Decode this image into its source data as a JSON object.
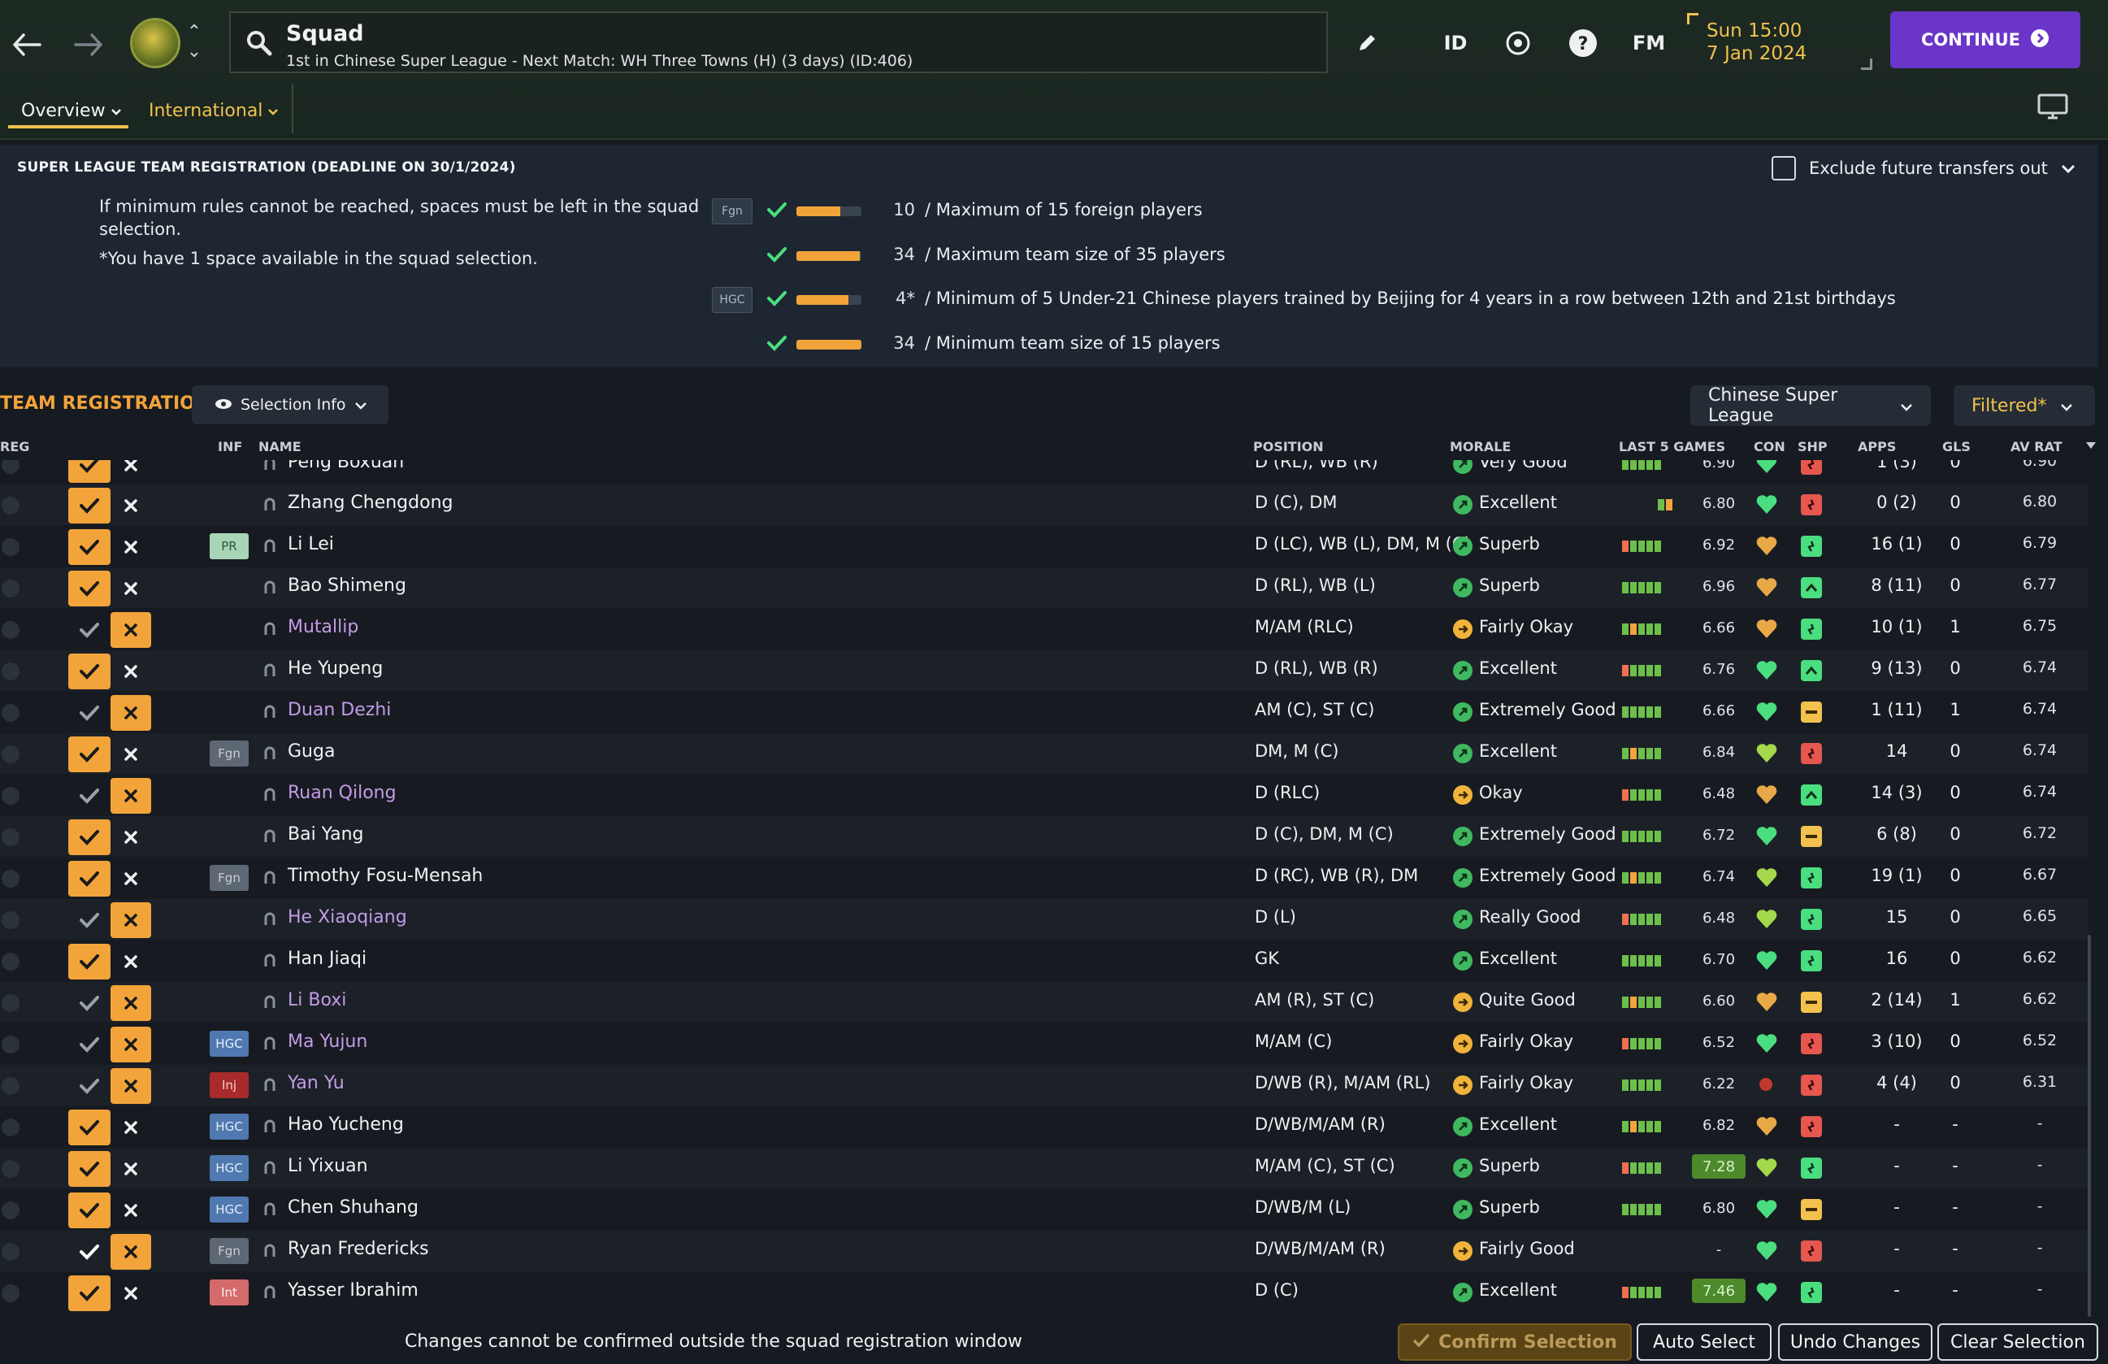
{
  "header": {
    "title": "Squad",
    "subtitle": "1st in Chinese Super League - Next Match: WH Three Towns (H) (3 days) (ID:406)",
    "id_label": "ID",
    "fm_label": "FM",
    "date_time": "Sun 15:00",
    "date": "7 Jan 2024",
    "continue_label": "CONTINUE"
  },
  "tabs": {
    "overview": "Overview",
    "international": "International"
  },
  "registration": {
    "title": "SUPER LEAGUE TEAM REGISTRATION (DEADLINE ON 30/1/2024)",
    "note": "If minimum rules cannot be reached, spaces must be left in the squad selection.",
    "note2": "*You have 1 space available in the squad selection.",
    "exclude_label": "Exclude future transfers out",
    "rules": [
      {
        "badge": "Fgn",
        "value": "10",
        "fill": 0.67,
        "text": "/  Maximum of 15 foreign players"
      },
      {
        "badge": "",
        "value": "34",
        "fill": 0.97,
        "text": "/  Maximum team size of 35 players"
      },
      {
        "badge": "HGC",
        "value": "4*",
        "fill": 0.8,
        "text": "/  Minimum of 5 Under-21 Chinese players trained by Beijing for 4 years in a row between 12th and 21st birthdays"
      },
      {
        "badge": "",
        "value": "34",
        "fill": 1.0,
        "text": "/  Minimum team size of 15 players"
      }
    ]
  },
  "team_reg": {
    "label": "TEAM REGISTRATION",
    "selection_info": "Selection Info",
    "league_filter": "Chinese Super League",
    "filtered": "Filtered*"
  },
  "columns": {
    "reg": "REG",
    "inf": "INF",
    "name": "NAME",
    "position": "POSITION",
    "morale": "MORALE",
    "last5": "LAST 5 GAMES",
    "con": "CON",
    "shp": "SHP",
    "apps": "APPS",
    "gls": "GLS",
    "avrat": "AV RAT"
  },
  "players": [
    {
      "name": "Peng Boxuan",
      "reg": true,
      "inf": "",
      "pos": "D (RL), WB (R)",
      "mood": "g",
      "morale": "Very Good",
      "avg": "6.90",
      "apps": "1 (3)",
      "gls": "0",
      "avrat": "6.90",
      "con": "#4ade80",
      "shp": "r",
      "hi": false,
      "partial": true
    },
    {
      "name": "Zhang Chengdong",
      "reg": true,
      "inf": "",
      "pos": "D (C), DM",
      "mood": "g",
      "morale": "Excellent",
      "avg": "6.80",
      "apps": "0 (2)",
      "gls": "0",
      "avrat": "6.80",
      "con": "#4ade80",
      "shp": "r",
      "hi": false
    },
    {
      "name": "Li Lei",
      "reg": true,
      "inf": "PR",
      "pos": "D (LC), WB (L), DM, M (C)",
      "mood": "g",
      "morale": "Superb",
      "avg": "6.92",
      "apps": "16 (1)",
      "gls": "0",
      "avrat": "6.79",
      "con": "#e8a847",
      "shp": "g",
      "hi": false
    },
    {
      "name": "Bao Shimeng",
      "reg": true,
      "inf": "",
      "pos": "D (RL), WB (L)",
      "mood": "g",
      "morale": "Superb",
      "avg": "6.96",
      "apps": "8 (11)",
      "gls": "0",
      "avrat": "6.77",
      "con": "#e8a847",
      "shp": "up",
      "hi": false
    },
    {
      "name": "Mutallip",
      "reg": false,
      "inf": "",
      "pos": "M/AM (RLC)",
      "mood": "y",
      "morale": "Fairly Okay",
      "avg": "6.66",
      "apps": "10 (1)",
      "gls": "1",
      "avrat": "6.75",
      "con": "#e8a847",
      "shp": "g",
      "hi": false
    },
    {
      "name": "He Yupeng",
      "reg": true,
      "inf": "",
      "pos": "D (RL), WB (R)",
      "mood": "g",
      "morale": "Excellent",
      "avg": "6.76",
      "apps": "9 (13)",
      "gls": "0",
      "avrat": "6.74",
      "con": "#4ade80",
      "shp": "up",
      "hi": false
    },
    {
      "name": "Duan Dezhi",
      "reg": false,
      "inf": "",
      "pos": "AM (C), ST (C)",
      "mood": "g",
      "morale": "Extremely Good",
      "avg": "6.66",
      "apps": "1 (11)",
      "gls": "1",
      "avrat": "6.74",
      "con": "#4ade80",
      "shp": "y",
      "hi": false
    },
    {
      "name": "Guga",
      "reg": true,
      "inf": "Fgn",
      "pos": "DM, M (C)",
      "mood": "g",
      "morale": "Excellent",
      "avg": "6.84",
      "apps": "14",
      "gls": "0",
      "avrat": "6.74",
      "con": "#a3d94a",
      "shp": "r",
      "hi": false
    },
    {
      "name": "Ruan Qilong",
      "reg": false,
      "inf": "",
      "pos": "D (RLC)",
      "mood": "y",
      "morale": "Okay",
      "avg": "6.48",
      "apps": "14 (3)",
      "gls": "0",
      "avrat": "6.74",
      "con": "#e8a847",
      "shp": "up",
      "hi": false
    },
    {
      "name": "Bai Yang",
      "reg": true,
      "inf": "",
      "pos": "D (C), DM, M (C)",
      "mood": "g",
      "morale": "Extremely Good",
      "avg": "6.72",
      "apps": "6 (8)",
      "gls": "0",
      "avrat": "6.72",
      "con": "#4ade80",
      "shp": "y",
      "hi": false
    },
    {
      "name": "Timothy Fosu-Mensah",
      "reg": true,
      "inf": "Fgn",
      "pos": "D (RC), WB (R), DM",
      "mood": "g",
      "morale": "Extremely Good",
      "avg": "6.74",
      "apps": "19 (1)",
      "gls": "0",
      "avrat": "6.67",
      "con": "#a3d94a",
      "shp": "g",
      "hi": false
    },
    {
      "name": "He Xiaoqiang",
      "reg": false,
      "inf": "",
      "pos": "D (L)",
      "mood": "g",
      "morale": "Really Good",
      "avg": "6.48",
      "apps": "15",
      "gls": "0",
      "avrat": "6.65",
      "con": "#a3d94a",
      "shp": "g",
      "hi": false
    },
    {
      "name": "Han Jiaqi",
      "reg": true,
      "inf": "",
      "pos": "GK",
      "mood": "g",
      "morale": "Excellent",
      "avg": "6.70",
      "apps": "16",
      "gls": "0",
      "avrat": "6.62",
      "con": "#4ade80",
      "shp": "g",
      "hi": false
    },
    {
      "name": "Li Boxi",
      "reg": false,
      "inf": "",
      "pos": "AM (R), ST (C)",
      "mood": "y",
      "morale": "Quite Good",
      "avg": "6.60",
      "apps": "2 (14)",
      "gls": "1",
      "avrat": "6.62",
      "con": "#e8a847",
      "shp": "y",
      "hi": false
    },
    {
      "name": "Ma Yujun",
      "reg": false,
      "inf": "HGC",
      "pos": "M/AM (C)",
      "mood": "y",
      "morale": "Fairly Okay",
      "avg": "6.52",
      "apps": "3 (10)",
      "gls": "0",
      "avrat": "6.52",
      "con": "#4ade80",
      "shp": "r",
      "hi": false
    },
    {
      "name": "Yan Yu",
      "reg": false,
      "inf": "Inj",
      "pos": "D/WB (R), M/AM (RL)",
      "mood": "y",
      "morale": "Fairly Okay",
      "avg": "6.22",
      "apps": "4 (4)",
      "gls": "0",
      "avrat": "6.31",
      "con": "#c0392b",
      "shp": "r",
      "hi": false
    },
    {
      "name": "Hao Yucheng",
      "reg": true,
      "inf": "HGC",
      "pos": "D/WB/M/AM (R)",
      "mood": "g",
      "morale": "Excellent",
      "avg": "6.82",
      "apps": "-",
      "gls": "-",
      "avrat": "-",
      "con": "#e8a847",
      "shp": "r",
      "hi": false
    },
    {
      "name": "Li Yixuan",
      "reg": true,
      "inf": "HGC",
      "pos": "M/AM (C), ST (C)",
      "mood": "g",
      "morale": "Superb",
      "avg": "7.28",
      "apps": "-",
      "gls": "-",
      "avrat": "-",
      "con": "#a3d94a",
      "shp": "g",
      "hi": true
    },
    {
      "name": "Chen Shuhang",
      "reg": true,
      "inf": "HGC",
      "pos": "D/WB/M (L)",
      "mood": "g",
      "morale": "Superb",
      "avg": "6.80",
      "apps": "-",
      "gls": "-",
      "avrat": "-",
      "con": "#4ade80",
      "shp": "y",
      "hi": false
    },
    {
      "name": "Ryan Fredericks",
      "reg": "reverse",
      "inf": "Fgn",
      "pos": "D/WB/M/AM (R)",
      "mood": "y",
      "morale": "Fairly Good",
      "avg": "-",
      "apps": "-",
      "gls": "-",
      "avrat": "-",
      "con": "#4ade80",
      "shp": "r",
      "hi": false,
      "nobar": true
    },
    {
      "name": "Yasser Ibrahim",
      "reg": true,
      "inf": "Int",
      "pos": "D (C)",
      "mood": "g",
      "morale": "Excellent",
      "avg": "7.46",
      "apps": "-",
      "gls": "-",
      "avrat": "-",
      "con": "#4ade80",
      "shp": "g",
      "hi": true
    }
  ],
  "footer": {
    "note": "Changes cannot be confirmed outside the squad registration window",
    "confirm": "Confirm Selection",
    "auto": "Auto Select",
    "undo": "Undo Changes",
    "clear": "Clear Selection"
  }
}
